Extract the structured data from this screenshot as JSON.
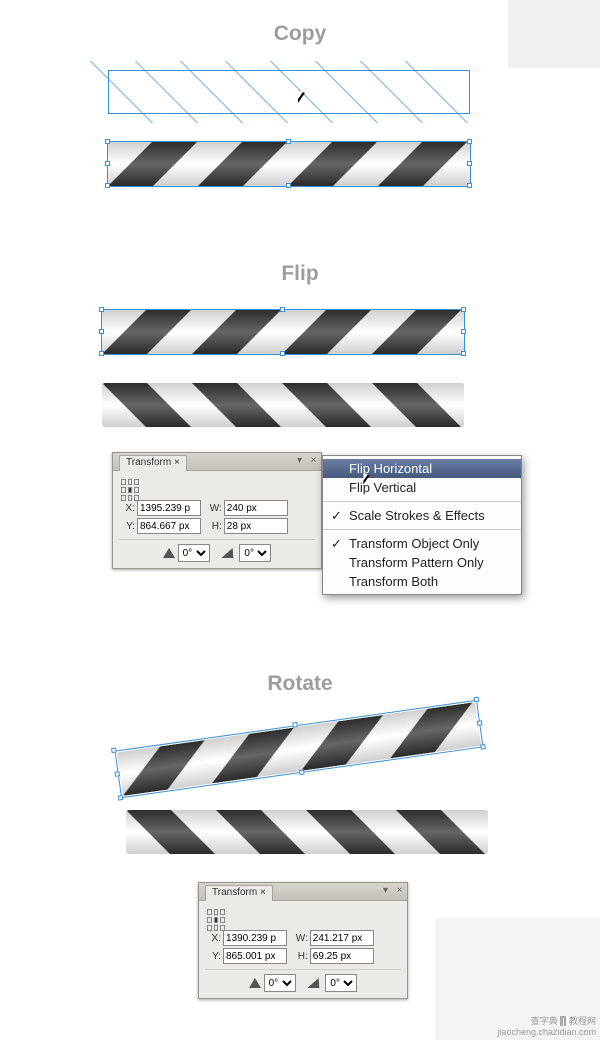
{
  "sections": {
    "copy": "Copy",
    "flip": "Flip",
    "rotate": "Rotate"
  },
  "panel1": {
    "tab": "Transform",
    "X": "1395.239 p",
    "Y": "864.667 px",
    "W": "240 px",
    "H": "28 px",
    "angle": "0°",
    "shear": "0°"
  },
  "panel2": {
    "tab": "Transform",
    "X": "1390.239 p",
    "Y": "865.001 px",
    "W": "241.217 px",
    "H": "69.25 px",
    "angle": "0°",
    "shear": "0°"
  },
  "menu": {
    "flipH": "Flip Horizontal",
    "flipV": "Flip Vertical",
    "scaleSE": "Scale Strokes & Effects",
    "tObj": "Transform Object Only",
    "tPat": "Transform Pattern Only",
    "tBoth": "Transform Both"
  },
  "watermark": {
    "line1": "查字典",
    "sep": "|",
    "line2": "教程网",
    "url": "jiaocheng.chazidian.com"
  }
}
